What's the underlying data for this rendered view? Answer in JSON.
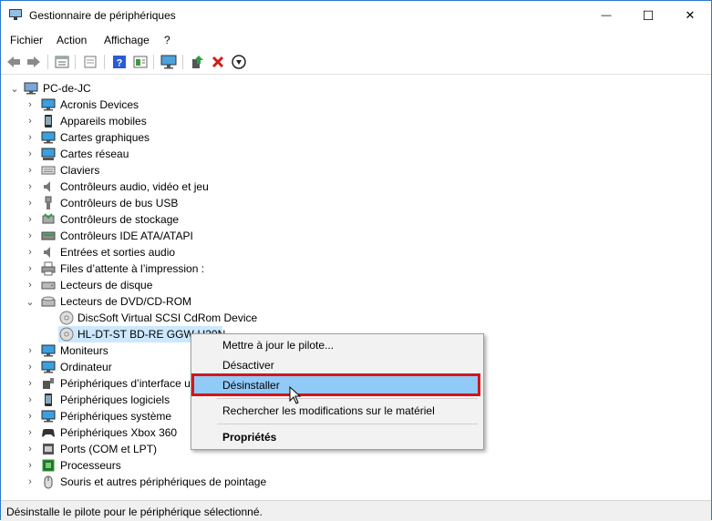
{
  "window": {
    "title": "Gestionnaire de périphériques",
    "minimize_glyph": "—",
    "maximize_glyph": "☐",
    "close_glyph": "✕"
  },
  "menubar": {
    "items": [
      "Fichier",
      "Action",
      "Affichage",
      "?"
    ]
  },
  "toolbar": {
    "buttons": [
      "back-icon",
      "forward-icon",
      "properties-icon",
      "hidden-devices-icon",
      "help-icon",
      "driver-icon",
      "monitor-icon",
      "update-driver-icon",
      "uninstall-icon",
      "download-icon"
    ]
  },
  "tree": {
    "root": "PC-de-JC",
    "categories": [
      {
        "label": "Acronis Devices",
        "icon": "monitor-icon"
      },
      {
        "label": "Appareils mobiles",
        "icon": "phone-icon"
      },
      {
        "label": "Cartes graphiques",
        "icon": "monitor-icon"
      },
      {
        "label": "Cartes réseau",
        "icon": "network-icon"
      },
      {
        "label": "Claviers",
        "icon": "keyboard-icon"
      },
      {
        "label": "Contrôleurs audio, vidéo et jeu",
        "icon": "speaker-icon"
      },
      {
        "label": "Contrôleurs de bus USB",
        "icon": "usb-icon"
      },
      {
        "label": "Contrôleurs de stockage",
        "icon": "storage-icon"
      },
      {
        "label": "Contrôleurs IDE ATA/ATAPI",
        "icon": "ide-icon"
      },
      {
        "label": "Entrées et sorties audio",
        "icon": "speaker-icon"
      },
      {
        "label": "Files d’attente à l’impression :",
        "icon": "printer-icon"
      },
      {
        "label": "Lecteurs de disque",
        "icon": "disk-icon"
      },
      {
        "label": "Lecteurs de DVD/CD-ROM",
        "icon": "dvd-icon",
        "expanded": true
      }
    ],
    "dvd_children": [
      "DiscSoft Virtual SCSI CdRom Device",
      "HL-DT-ST BD-RE  GGW-H20N"
    ],
    "categories_after": [
      {
        "label": "Moniteurs",
        "icon": "monitor-icon"
      },
      {
        "label": "Ordinateur",
        "icon": "monitor-icon"
      },
      {
        "label": "Périphériques d’interface utilisateur",
        "icon": "hid-icon"
      },
      {
        "label": "Périphériques logiciels",
        "icon": "phone-icon"
      },
      {
        "label": "Périphériques système",
        "icon": "monitor-icon"
      },
      {
        "label": "Périphériques Xbox 360",
        "icon": "gamepad-icon"
      },
      {
        "label": "Ports (COM et LPT)",
        "icon": "port-icon"
      },
      {
        "label": "Processeurs",
        "icon": "cpu-icon"
      },
      {
        "label": "Souris et autres périphériques de pointage",
        "icon": "mouse-icon"
      }
    ]
  },
  "context_menu": {
    "items": [
      "Mettre à jour le pilote...",
      "Désactiver",
      "Désinstaller",
      "Rechercher les modifications sur le matériel",
      "Propriétés"
    ],
    "highlighted": "Désinstaller",
    "highlight_color": "#91c9f7",
    "callout_color": "#d3151d"
  },
  "statusbar": {
    "text": "Désinstalle le pilote pour le périphérique sélectionné."
  }
}
